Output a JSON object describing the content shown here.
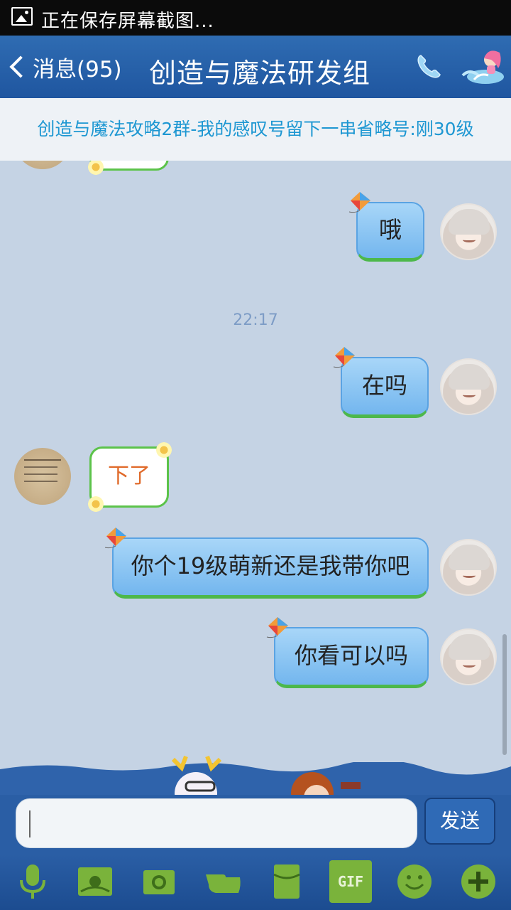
{
  "status_bar": {
    "text": "正在保存屏幕截图..."
  },
  "header": {
    "back_label": "消息(95)",
    "title": "创造与魔法研发组"
  },
  "notice": {
    "text": "创造与魔法攻略2群-我的感叹号留下一串省略号:刚30级"
  },
  "messages": [
    {
      "side": "right",
      "text": "哦"
    },
    {
      "side": "center",
      "text": "22:17"
    },
    {
      "side": "right",
      "text": "在吗"
    },
    {
      "side": "left",
      "text": "下了"
    },
    {
      "side": "right",
      "text": "你个19级萌新还是我带你吧"
    },
    {
      "side": "right",
      "text": "你看可以吗"
    }
  ],
  "input": {
    "placeholder": ""
  },
  "send_label": "发送",
  "toolbar": {
    "gif_label": "GIF"
  },
  "colors": {
    "accent": "#1f56a0",
    "bubble_out": "#73b6ee",
    "bubble_in_border": "#5cc34a",
    "tool_green": "#7ab33b"
  }
}
